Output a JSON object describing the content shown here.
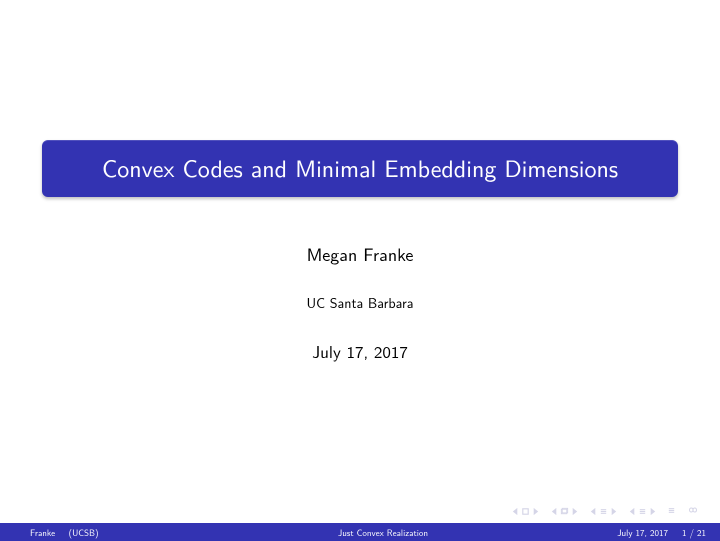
{
  "title": "Convex Codes and Minimal Embedding Dimensions",
  "author": "Megan Franke",
  "institution": "UC Santa Barbara",
  "date": "July 17, 2017",
  "footer": {
    "author_short": "Franke",
    "inst_short": "(UCSB)",
    "short_title": "Just Convex Realization",
    "date": "July 17, 2017",
    "page_current": "1",
    "page_sep": " / ",
    "page_total": "21"
  }
}
